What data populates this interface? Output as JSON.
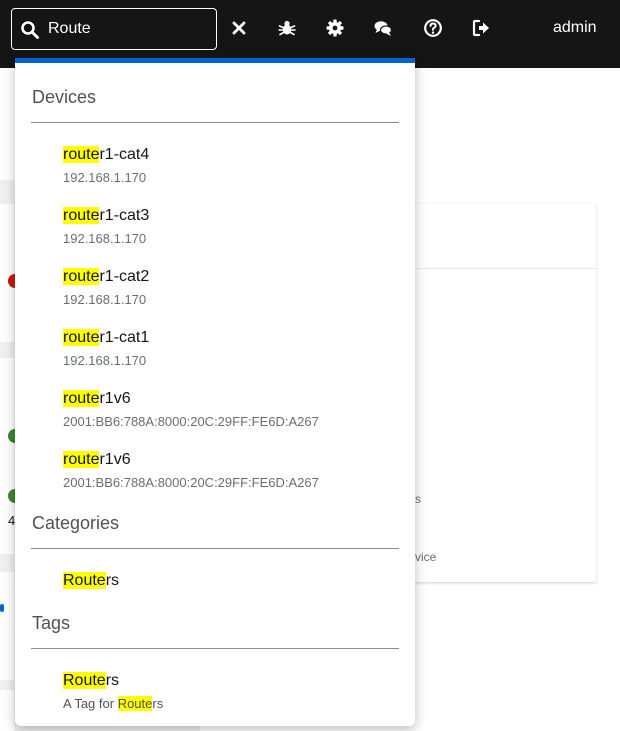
{
  "search": {
    "value": "Route",
    "query": "Route"
  },
  "user": {
    "name": "admin"
  },
  "toolbar_icons": [
    "close-icon",
    "bug-icon",
    "gear-icon",
    "comments-icon",
    "help-icon",
    "logout-icon"
  ],
  "background": {
    "text_s": "s",
    "text_vice": "vice",
    "count": "4"
  },
  "results": {
    "devices_title": "Devices",
    "devices": [
      {
        "match": "route",
        "rest": "r1-cat4",
        "ip": "192.168.1.170"
      },
      {
        "match": "route",
        "rest": "r1-cat3",
        "ip": "192.168.1.170"
      },
      {
        "match": "route",
        "rest": "r1-cat2",
        "ip": "192.168.1.170"
      },
      {
        "match": "route",
        "rest": "r1-cat1",
        "ip": "192.168.1.170"
      },
      {
        "match": "route",
        "rest": "r1v6",
        "ip": "2001:BB6:788A:8000:20C:29FF:FE6D:A267"
      },
      {
        "match": "route",
        "rest": "r1v6",
        "ip": "2001:BB6:788A:8000:20C:29FF:FE6D:A267"
      }
    ],
    "categories_title": "Categories",
    "categories": [
      {
        "match": "Route",
        "rest": "rs"
      }
    ],
    "tags_title": "Tags",
    "tags": [
      {
        "match": "Route",
        "rest": "rs",
        "desc_pre": "A Tag for ",
        "desc_match": "Route",
        "desc_post": "rs"
      }
    ]
  },
  "colors": {
    "accent": "#0066cc",
    "highlight": "#ffff00",
    "topbar": "#151515"
  }
}
